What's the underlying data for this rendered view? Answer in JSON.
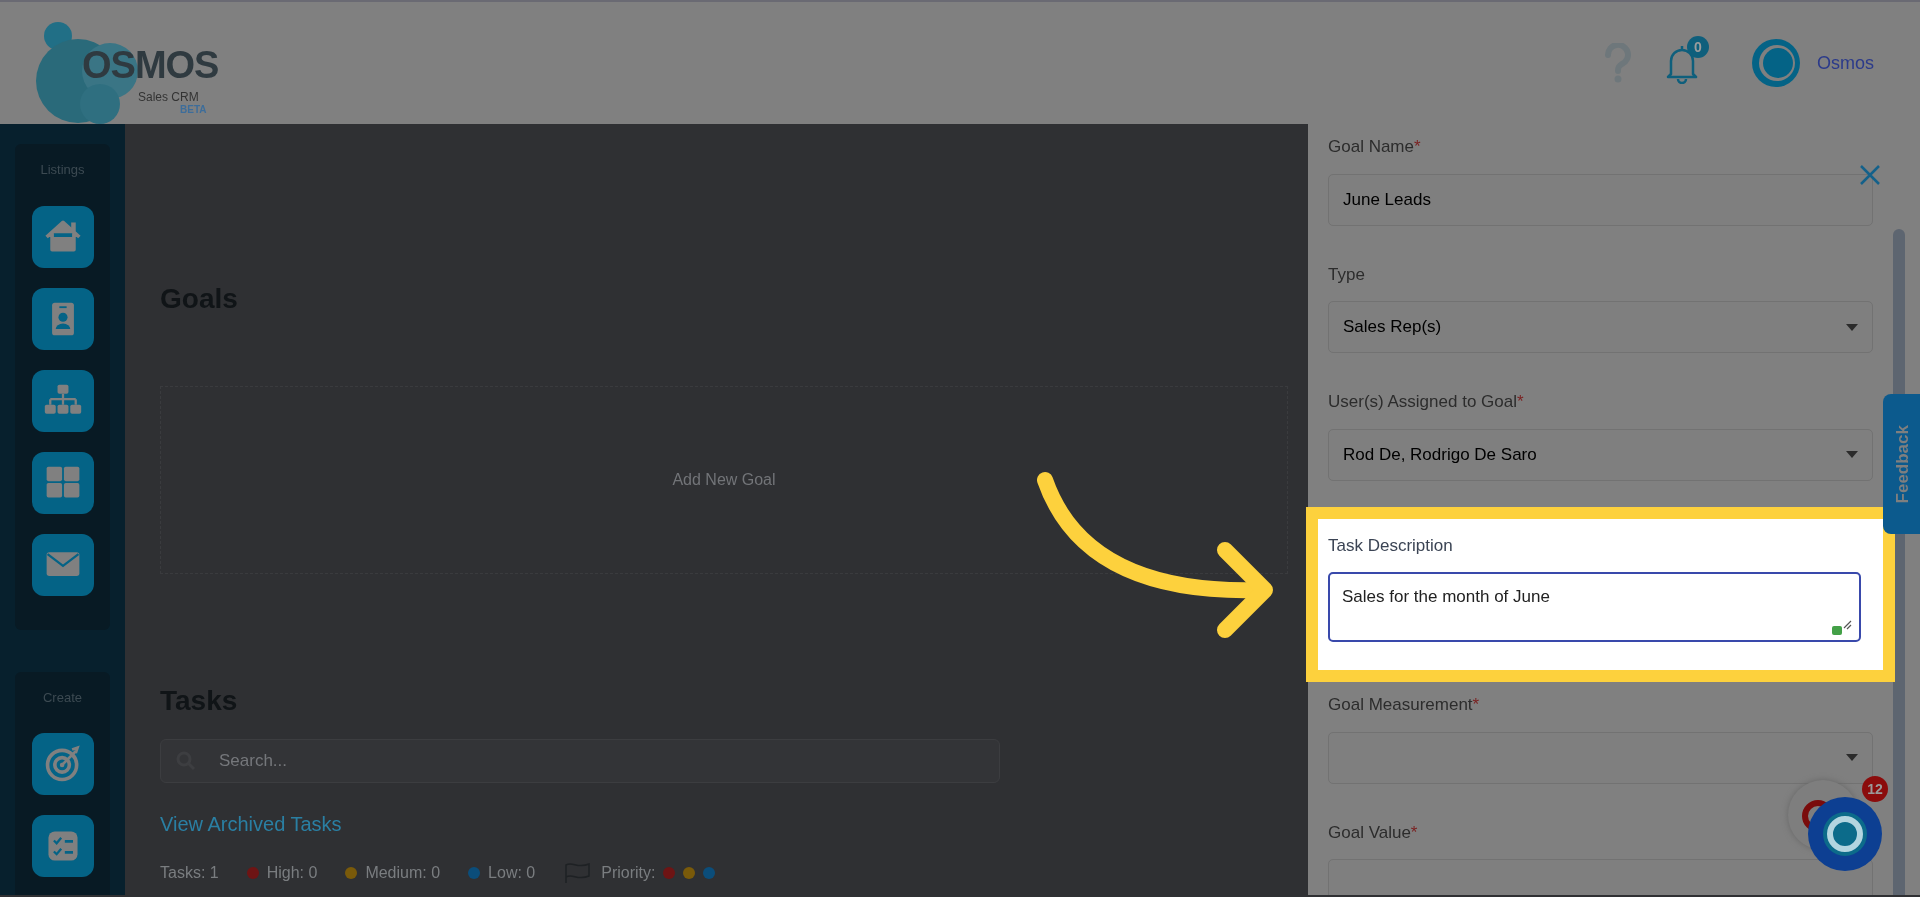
{
  "header": {
    "logo": {
      "name": "OSMOS",
      "subtitle": "Sales CRM",
      "tag": "BETA"
    },
    "notifications": {
      "count": "0"
    },
    "user": {
      "name": "Osmos"
    }
  },
  "sidebar": [
    {
      "title": "Listings",
      "items": [
        {
          "kind": "house"
        },
        {
          "kind": "contact"
        },
        {
          "kind": "hierarchy"
        },
        {
          "kind": "grid"
        },
        {
          "kind": "mail"
        }
      ]
    },
    {
      "title": "Create",
      "items": [
        {
          "kind": "target"
        },
        {
          "kind": "checklist"
        }
      ]
    }
  ],
  "goals": {
    "title": "Goals",
    "empty_text": "Add New Goal"
  },
  "tasks": {
    "title": "Tasks",
    "search": {
      "placeholder": "Search..."
    },
    "archived_link": "View Archived Tasks",
    "summary": [
      {
        "label": "Tasks: 1"
      },
      {
        "label": "High: 0",
        "color": "#6e1414"
      },
      {
        "label": "Medium: 0",
        "color": "#7a5a0a"
      },
      {
        "label": "Low: 0",
        "color": "#0b4d7a"
      }
    ],
    "priority_label": "Priority:",
    "priority_dots": [
      {
        "color": "#6e1414"
      },
      {
        "color": "#7a5a0a"
      },
      {
        "color": "#0b4d7a"
      }
    ]
  },
  "drawer": {
    "fields": [
      {
        "kind": "text",
        "label": "Goal Name",
        "required_mark": "*",
        "value": "June Leads",
        "highlighted": false
      },
      {
        "kind": "select",
        "label": "Type",
        "value": "Sales Rep(s)",
        "highlighted": false
      },
      {
        "kind": "select",
        "label": "User(s) Assigned to Goal",
        "required_mark": "*",
        "value": "Rod De, Rodrigo De Saro",
        "highlighted": false
      },
      {
        "kind": "textarea",
        "label": "Task Description",
        "value": "Sales for the month of June",
        "highlighted": true
      },
      {
        "kind": "select",
        "label": "Goal Measurement",
        "required_mark": "*",
        "highlighted": false
      },
      {
        "kind": "text",
        "label": "Goal Value",
        "required_mark": "*",
        "highlighted": false
      }
    ]
  },
  "feedback_tab": "Feedback",
  "chat": {
    "badge": "12"
  }
}
